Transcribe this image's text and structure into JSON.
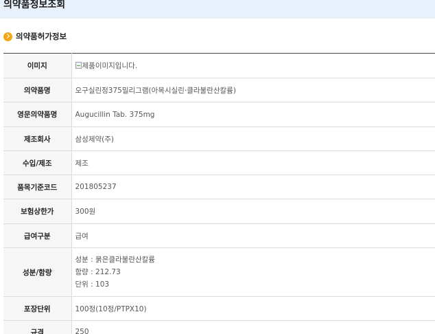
{
  "header": {
    "title": "의약품정보조회"
  },
  "section": {
    "title": "의약품허가정보",
    "icon": "chevron-right-circle-icon",
    "accent": "#f2a818"
  },
  "rows": {
    "image": {
      "label": "이미지",
      "alt": "제품이미지입니다.",
      "icon": "broken-image-icon"
    },
    "product_name": {
      "label": "의약품명",
      "value": "오구실린정375밀리그램(아목시실린·클라불란산칼륨)"
    },
    "english_name": {
      "label": "영문의약품명",
      "value": "Augucillin Tab. 375mg"
    },
    "manufacturer": {
      "label": "제조회사",
      "value": "삼성제약(주)"
    },
    "import_type": {
      "label": "수입/제조",
      "value": "제조"
    },
    "item_code": {
      "label": "품목기준코드",
      "value": "201805237"
    },
    "max_price": {
      "label": "보험상한가",
      "value": "300원"
    },
    "benefit_type": {
      "label": "급여구분",
      "value": "급여"
    },
    "composition": {
      "label": "성분/함량",
      "lines": [
        "성분 : 묽은클라불란산칼륨",
        "함량 : 212.73",
        "단위 : 103"
      ]
    },
    "package_unit": {
      "label": "포장단위",
      "value": "100정(10정/PTPX10)"
    },
    "spec": {
      "label": "규격",
      "value": "250"
    }
  }
}
